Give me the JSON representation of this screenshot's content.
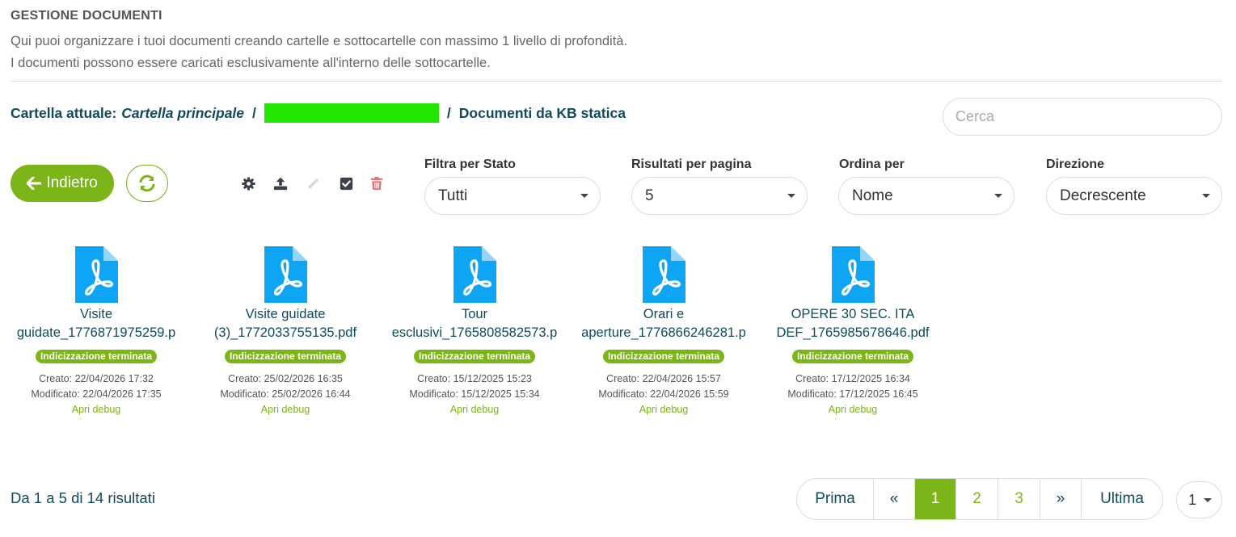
{
  "header": {
    "title": "GESTIONE DOCUMENTI",
    "desc_line1": "Qui puoi organizzare i tuoi documenti creando cartelle e sottocartelle con massimo 1 livello di profondità.",
    "desc_line2": "I documenti possono essere caricati esclusivamente all'interno delle sottocartelle."
  },
  "breadcrumb": {
    "prefix": "Cartella attuale:",
    "root": "Cartella principale",
    "separator": "/",
    "current": "Documenti da KB statica",
    "redacted_color": "#22e600"
  },
  "search": {
    "placeholder": "Cerca",
    "value": ""
  },
  "toolbar": {
    "back_label": "Indietro",
    "back_icon": "arrow-left-icon",
    "refresh_icon": "refresh-icon",
    "tools": [
      "gear-icon",
      "upload-icon",
      "pencil-icon",
      "checkbox-icon",
      "trash-icon"
    ]
  },
  "filters": {
    "status": {
      "label": "Filtra per Stato",
      "value": "Tutti"
    },
    "per_page": {
      "label": "Risultati per pagina",
      "value": "5"
    },
    "sort": {
      "label": "Ordina per",
      "value": "Nome"
    },
    "direction": {
      "label": "Direzione",
      "value": "Decrescente"
    }
  },
  "documents": [
    {
      "line1": "Visite",
      "line2": "guidate_1776871975259.p",
      "badge": "Indicizzazione terminata",
      "created": "Creato: 22/04/2026 17:32",
      "modified": "Modificato: 22/04/2026 17:35",
      "debug": "Apri debug"
    },
    {
      "line1": "Visite guidate",
      "line2": "(3)_1772033755135.pdf",
      "badge": "Indicizzazione terminata",
      "created": "Creato: 25/02/2026 16:35",
      "modified": "Modificato: 25/02/2026 16:44",
      "debug": "Apri debug"
    },
    {
      "line1": "Tour",
      "line2": "esclusivi_1765808582573.p",
      "badge": "Indicizzazione terminata",
      "created": "Creato: 15/12/2025 15:23",
      "modified": "Modificato: 15/12/2025 15:34",
      "debug": "Apri debug"
    },
    {
      "line1": "Orari e",
      "line2": "aperture_1776866246281.p",
      "badge": "Indicizzazione terminata",
      "created": "Creato: 22/04/2026 15:57",
      "modified": "Modificato: 22/04/2026 15:59",
      "debug": "Apri debug"
    },
    {
      "line1": "OPERE 30 SEC. ITA",
      "line2": "DEF_1765985678646.pdf",
      "badge": "Indicizzazione terminata",
      "created": "Creato: 17/12/2025 16:34",
      "modified": "Modificato: 17/12/2025 16:45",
      "debug": "Apri debug"
    }
  ],
  "pagination": {
    "summary": "Da 1 a 5 di 14 risultati",
    "first": "Prima",
    "prev": "«",
    "pages": [
      "1",
      "2",
      "3"
    ],
    "current_page": "1",
    "next": "»",
    "last": "Ultima",
    "page_select": "1"
  },
  "colors": {
    "accent": "#7cb518",
    "text_dark": "#0f4b5c",
    "pdf_blue": "#0ea5f5",
    "trash_red": "#e57373"
  }
}
